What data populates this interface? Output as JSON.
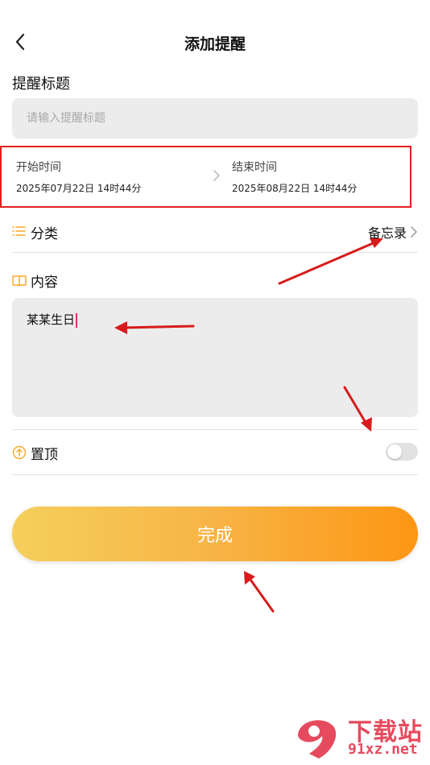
{
  "header": {
    "title": "添加提醒"
  },
  "reminder_title": {
    "label": "提醒标题",
    "placeholder": "请输入提醒标题"
  },
  "time": {
    "start_label": "开始时间",
    "start_value": "2025年07月22日 14时44分",
    "end_label": "结束时间",
    "end_value": "2025年08月22日 14时44分"
  },
  "category": {
    "label": "分类",
    "value": "备忘录"
  },
  "content": {
    "label": "内容",
    "value": "某某生日"
  },
  "pin": {
    "label": "置顶",
    "enabled": false
  },
  "done_button": {
    "label": "完成"
  },
  "colors": {
    "accent": "#f7a82a",
    "highlight_box": "#e02020",
    "annotation_arrow": "#d81b1b",
    "button_gradient_start": "#f5cf5c",
    "button_gradient_end": "#fd9613"
  },
  "watermark": {
    "top": "下载站",
    "bottom": "91xz.net"
  }
}
